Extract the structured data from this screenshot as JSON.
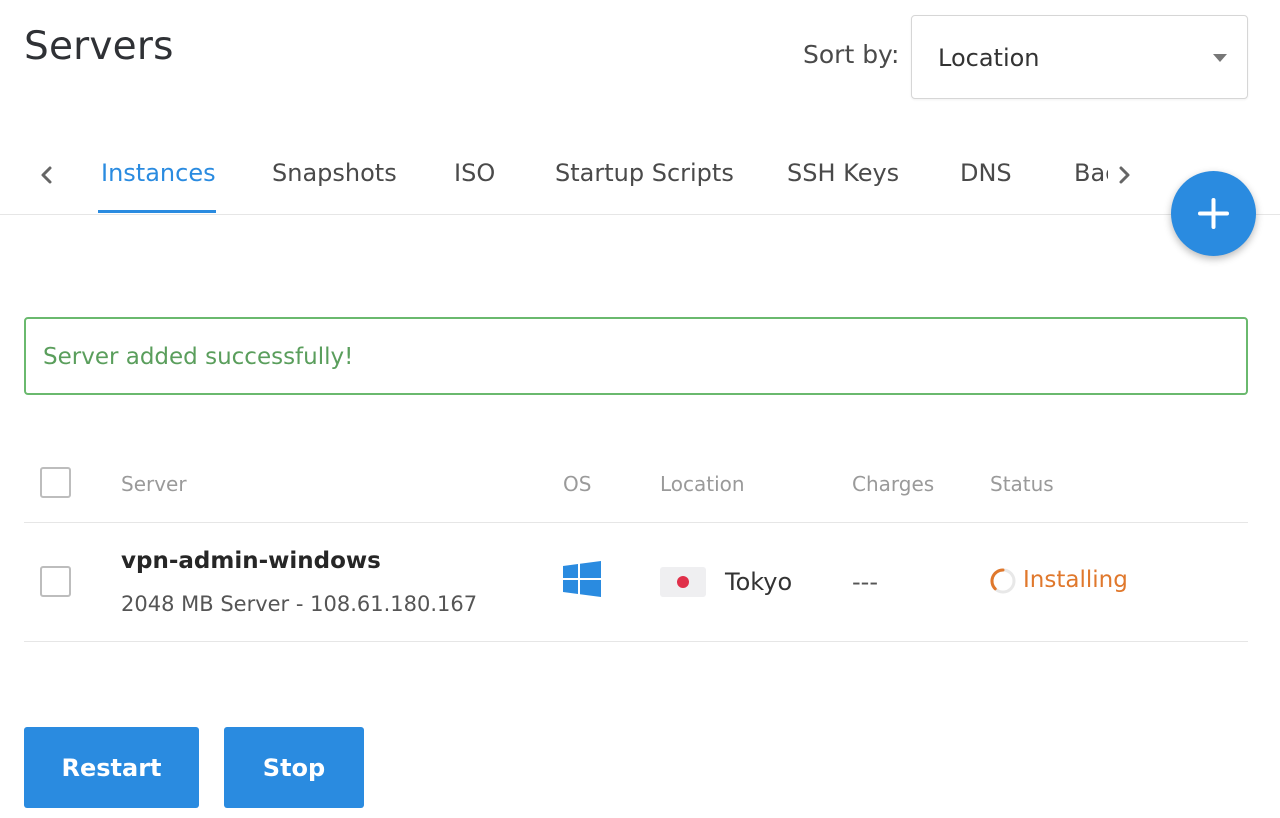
{
  "header": {
    "title": "Servers",
    "sort_label": "Sort by:",
    "sort_value": "Location"
  },
  "tabs": [
    {
      "label": "Instances",
      "active": true
    },
    {
      "label": "Snapshots",
      "active": false
    },
    {
      "label": "ISO",
      "active": false
    },
    {
      "label": "Startup Scripts",
      "active": false
    },
    {
      "label": "SSH Keys",
      "active": false
    },
    {
      "label": "DNS",
      "active": false
    },
    {
      "label": "Backups",
      "active": false
    }
  ],
  "alert": {
    "message": "Server added successfully!"
  },
  "table": {
    "columns": [
      "Server",
      "OS",
      "Location",
      "Charges",
      "Status"
    ],
    "rows": [
      {
        "name": "vpn-admin-windows",
        "details": "2048 MB Server - 108.61.180.167",
        "os_icon": "windows-icon",
        "location_flag": "japan-flag-icon",
        "location": "Tokyo",
        "charges": "---",
        "status": "Installing",
        "status_icon": "spinner-icon"
      }
    ]
  },
  "actions": {
    "restart_label": "Restart",
    "stop_label": "Stop"
  },
  "colors": {
    "accent": "#2a8be0",
    "success_border": "#6ab96e",
    "success_text": "#5a9e5c",
    "installing": "#e0782c",
    "japan_red": "#e0304a"
  }
}
